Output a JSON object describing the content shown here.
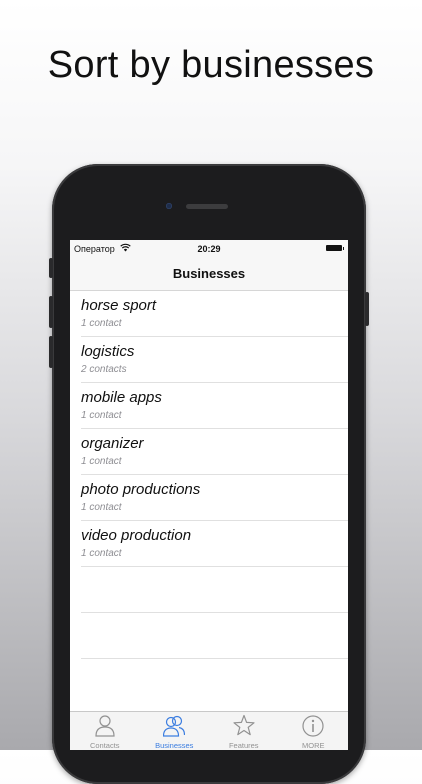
{
  "headline": "Sort by businesses",
  "status_bar": {
    "carrier": "Оператор",
    "time": "20:29"
  },
  "nav": {
    "title": "Businesses"
  },
  "businesses": [
    {
      "name": "horse sport",
      "count": "1 contact"
    },
    {
      "name": "logistics",
      "count": "2 contacts"
    },
    {
      "name": "mobile apps",
      "count": "1 contact"
    },
    {
      "name": "organizer",
      "count": "1 contact"
    },
    {
      "name": "photo productions",
      "count": "1 contact"
    },
    {
      "name": "video production",
      "count": "1 contact"
    }
  ],
  "tabs": [
    {
      "label": "Contacts",
      "icon": "person-icon",
      "active": false
    },
    {
      "label": "Businesses",
      "icon": "group-icon",
      "active": true
    },
    {
      "label": "Features",
      "icon": "star-icon",
      "active": false
    },
    {
      "label": "MORE",
      "icon": "info-icon",
      "active": false
    }
  ],
  "colors": {
    "accent": "#3b7de0",
    "inactive": "#929292"
  }
}
